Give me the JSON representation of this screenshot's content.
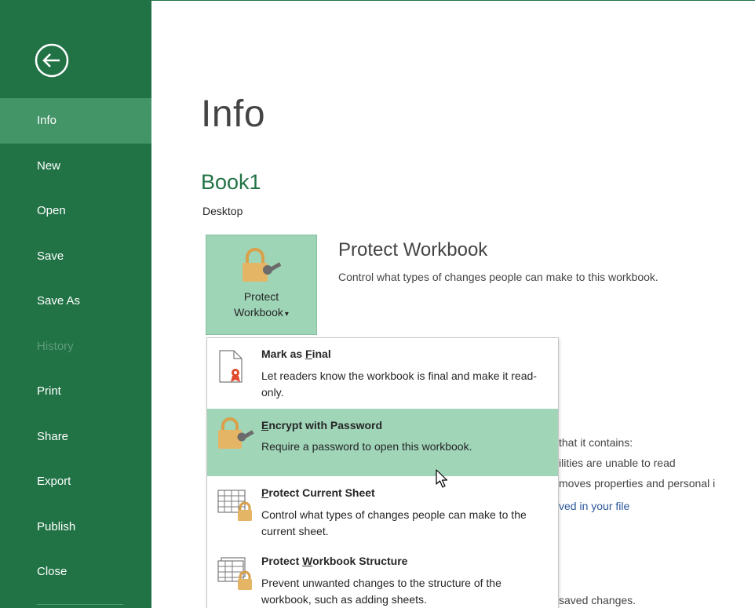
{
  "sidebar": {
    "items": [
      {
        "label": "Info"
      },
      {
        "label": "New"
      },
      {
        "label": "Open"
      },
      {
        "label": "Save"
      },
      {
        "label": "Save As"
      },
      {
        "label": "History"
      },
      {
        "label": "Print"
      },
      {
        "label": "Share"
      },
      {
        "label": "Export"
      },
      {
        "label": "Publish"
      },
      {
        "label": "Close"
      }
    ]
  },
  "main": {
    "title": "Info",
    "file_name": "Book1",
    "file_location": "Desktop",
    "protect_button": {
      "line1": "Protect",
      "line2": "Workbook",
      "arrow": "▾"
    },
    "protect_title": "Protect Workbook",
    "protect_desc": "Control what types of changes people can make to this workbook.",
    "behind_text": {
      "line1": "that it contains:",
      "line2": "ilities are unable to read",
      "line3": "moves properties and personal i",
      "link": "ved in your file",
      "line4": "saved changes."
    }
  },
  "menu": {
    "items": [
      {
        "title_pre": "Mark as ",
        "title_u": "F",
        "title_post": "inal",
        "desc": "Let readers know the workbook is final and make it read-only."
      },
      {
        "title_pre": "",
        "title_u": "E",
        "title_post": "ncrypt with Password",
        "desc": "Require a password to open this workbook."
      },
      {
        "title_pre": "",
        "title_u": "P",
        "title_post": "rotect Current Sheet",
        "desc": "Control what types of changes people can make to the current sheet."
      },
      {
        "title_pre": "Protect ",
        "title_u": "W",
        "title_post": "orkbook Structure",
        "desc": "Prevent unwanted changes to the structure of the workbook, such as adding sheets."
      }
    ]
  },
  "colors": {
    "sidebar": "#217346",
    "active": "#439467",
    "hover": "#a0d5b8",
    "accent_text": "#217346",
    "lock": "#e5b566"
  },
  "icons": {
    "back": "back-arrow-icon",
    "protect": "lock-key-icon",
    "final": "document-ribbon-icon",
    "encrypt": "lock-key-icon",
    "sheet": "sheet-lock-icon",
    "structure": "workbook-lock-icon"
  }
}
